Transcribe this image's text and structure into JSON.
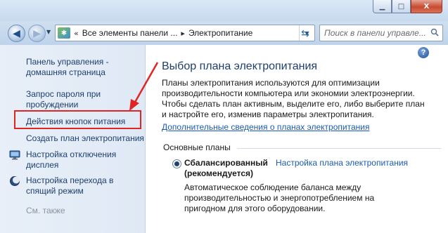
{
  "window": {
    "minimize_glyph": "▁",
    "maximize_glyph": "□",
    "close_glyph": "X"
  },
  "nav": {
    "back_glyph": "◀",
    "forward_glyph": "▶",
    "dropdown_glyph": "▼"
  },
  "address": {
    "overflow": "«",
    "crumbs": [
      "Все элементы панели ...",
      "Электропитание"
    ],
    "sep": "▸"
  },
  "search": {
    "placeholder": "Поиск в панели управле..."
  },
  "sidebar": {
    "items": [
      {
        "label_1": "Панель управления -",
        "label_2": "домашняя страница"
      },
      {
        "label_1": "Запрос пароля при",
        "label_2": "пробуждении"
      },
      {
        "label_1": "Действия кнопок питания"
      },
      {
        "label_1": "Создать план электропитания"
      },
      {
        "label_1": "Настройка отключения",
        "label_2": "дисплея"
      },
      {
        "label_1": "Настройка перехода в",
        "label_2": "спящий режим"
      }
    ],
    "see_also": "См. также"
  },
  "main": {
    "help_glyph": "?",
    "title": "Выбор плана электропитания",
    "desc_lines": [
      "Планы электропитания используются для оптимизации",
      "производительности компьютера или экономии электроэнергии.",
      "Чтобы сделать план активным, выделите его, либо выберите план",
      "и настройте его, изменив параметры электропитания."
    ],
    "more_link": "Дополнительные сведения о планах электропитания",
    "section_label": "Основные планы",
    "plan": {
      "name_1": "Сбалансированный",
      "name_2": "(рекомендуется)",
      "settings_link": "Настройка плана электропитания",
      "desc_lines": [
        "Автоматическое соблюдение баланса между",
        "производительностью и энергопотреблением на",
        "пригодном для этого оборудовании."
      ],
      "selected": true
    }
  },
  "colors": {
    "link": "#1e3f6e",
    "highlight_box": "#e02525",
    "arrow": "#e02525"
  }
}
